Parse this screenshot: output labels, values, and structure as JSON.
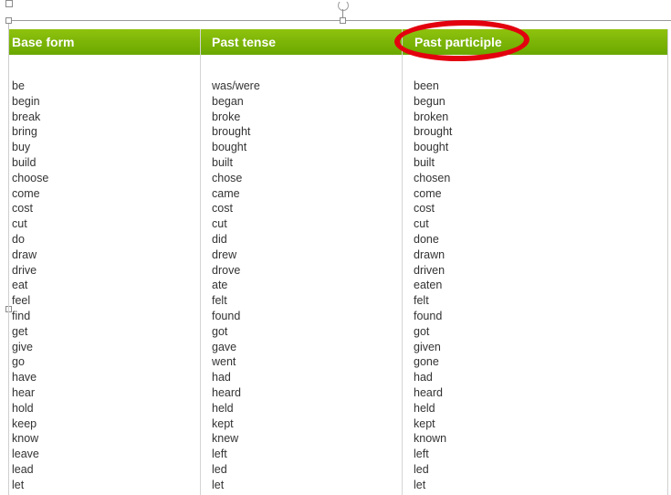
{
  "table": {
    "headers": {
      "base_form": "Base form",
      "past_tense": "Past tense",
      "past_participle": "Past participle"
    },
    "colors": {
      "header_green_top": "#8fc20e",
      "header_green_bottom": "#6aa800",
      "highlight_red": "#e3000f"
    },
    "rows": [
      {
        "base": "be",
        "past": "was/were",
        "participle": "been"
      },
      {
        "base": "begin",
        "past": "began",
        "participle": "begun"
      },
      {
        "base": "break",
        "past": "broke",
        "participle": "broken"
      },
      {
        "base": "bring",
        "past": "brought",
        "participle": "brought"
      },
      {
        "base": "buy",
        "past": "bought",
        "participle": "bought"
      },
      {
        "base": "build",
        "past": "built",
        "participle": "built"
      },
      {
        "base": "choose",
        "past": "chose",
        "participle": "chosen"
      },
      {
        "base": "come",
        "past": "came",
        "participle": "come"
      },
      {
        "base": "cost",
        "past": "cost",
        "participle": "cost"
      },
      {
        "base": "cut",
        "past": "cut",
        "participle": "cut"
      },
      {
        "base": "do",
        "past": "did",
        "participle": "done"
      },
      {
        "base": "draw",
        "past": "drew",
        "participle": "drawn"
      },
      {
        "base": "drive",
        "past": "drove",
        "participle": "driven"
      },
      {
        "base": "eat",
        "past": "ate",
        "participle": "eaten"
      },
      {
        "base": "feel",
        "past": "felt",
        "participle": "felt"
      },
      {
        "base": "find",
        "past": "found",
        "participle": "found"
      },
      {
        "base": "get",
        "past": "got",
        "participle": "got"
      },
      {
        "base": "give",
        "past": "gave",
        "participle": "given"
      },
      {
        "base": "go",
        "past": "went",
        "participle": "gone"
      },
      {
        "base": "have",
        "past": "had",
        "participle": "had"
      },
      {
        "base": "hear",
        "past": "heard",
        "participle": "heard"
      },
      {
        "base": "hold",
        "past": "held",
        "participle": "held"
      },
      {
        "base": "keep",
        "past": "kept",
        "participle": "kept"
      },
      {
        "base": "know",
        "past": "knew",
        "participle": "known"
      },
      {
        "base": "leave",
        "past": "left",
        "participle": "left"
      },
      {
        "base": "lead",
        "past": "led",
        "participle": "led"
      },
      {
        "base": "let",
        "past": "let",
        "participle": "let"
      }
    ]
  }
}
